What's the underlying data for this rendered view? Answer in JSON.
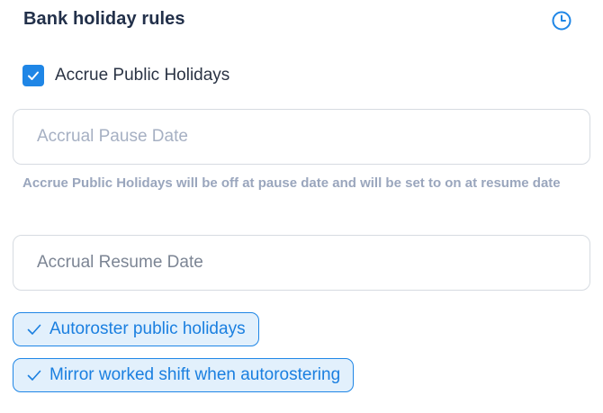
{
  "section": {
    "title": "Bank holiday rules",
    "history_icon": "clock-icon"
  },
  "accrue": {
    "label": "Accrue Public Holidays",
    "checked": true
  },
  "pause_field": {
    "value": "",
    "placeholder": "Accrual Pause Date"
  },
  "helper_text": "Accrue Public Holidays will be off at pause date and will be set to on at resume date",
  "resume_field": {
    "value": "",
    "placeholder": "Accrual Resume Date"
  },
  "chips": [
    {
      "label": "Autoroster public holidays",
      "selected": true,
      "icon": "check-icon"
    },
    {
      "label": "Mirror worked shift when autorostering",
      "selected": true,
      "icon": "check-icon"
    }
  ],
  "colors": {
    "accent": "#1f86e6",
    "chip_bg": "#e2f0fc",
    "helper": "#9aa6bd",
    "border": "#d6dbe1"
  }
}
